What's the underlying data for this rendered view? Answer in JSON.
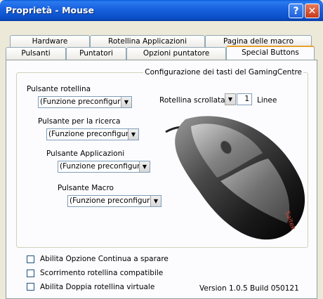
{
  "window": {
    "title": "Proprietà - Mouse",
    "help_label": "?",
    "close_label": "✕"
  },
  "tabs_back": [
    "Hardware",
    "Rotellina Applicazioni",
    "Pagina delle macro"
  ],
  "tabs_front": [
    "Pulsanti",
    "Puntatori",
    "Opzioni puntatore",
    "Special Buttons"
  ],
  "active_tab": "Special Buttons",
  "group": {
    "label": "Configurazione dei tasti del GamingCentre"
  },
  "buttons": [
    {
      "label": "Pulsante rotellina",
      "value": "(Funzione preconfigur"
    },
    {
      "label": "Pulsante per la ricerca",
      "value": "(Funzione preconfigur"
    },
    {
      "label": "Pulsante Applicazioni",
      "value": "(Funzione preconfigur"
    },
    {
      "label": "Pulsante Macro",
      "value": "(Funzione preconfigur"
    }
  ],
  "scroll": {
    "label": "Rotellina scrollata",
    "value": "1",
    "unit": "Linee"
  },
  "mouse_brand": "Saitek",
  "checkboxes": [
    {
      "label": "Abilita Opzione Continua a sparare",
      "checked": false
    },
    {
      "label": "Scorrimento rotellina compatibile",
      "checked": false
    },
    {
      "label": "Abilita Doppia rotellina virtuale",
      "checked": false
    }
  ],
  "version": "Version 1.0.5 Build 050121",
  "icons": {
    "dropdown": "▼"
  }
}
